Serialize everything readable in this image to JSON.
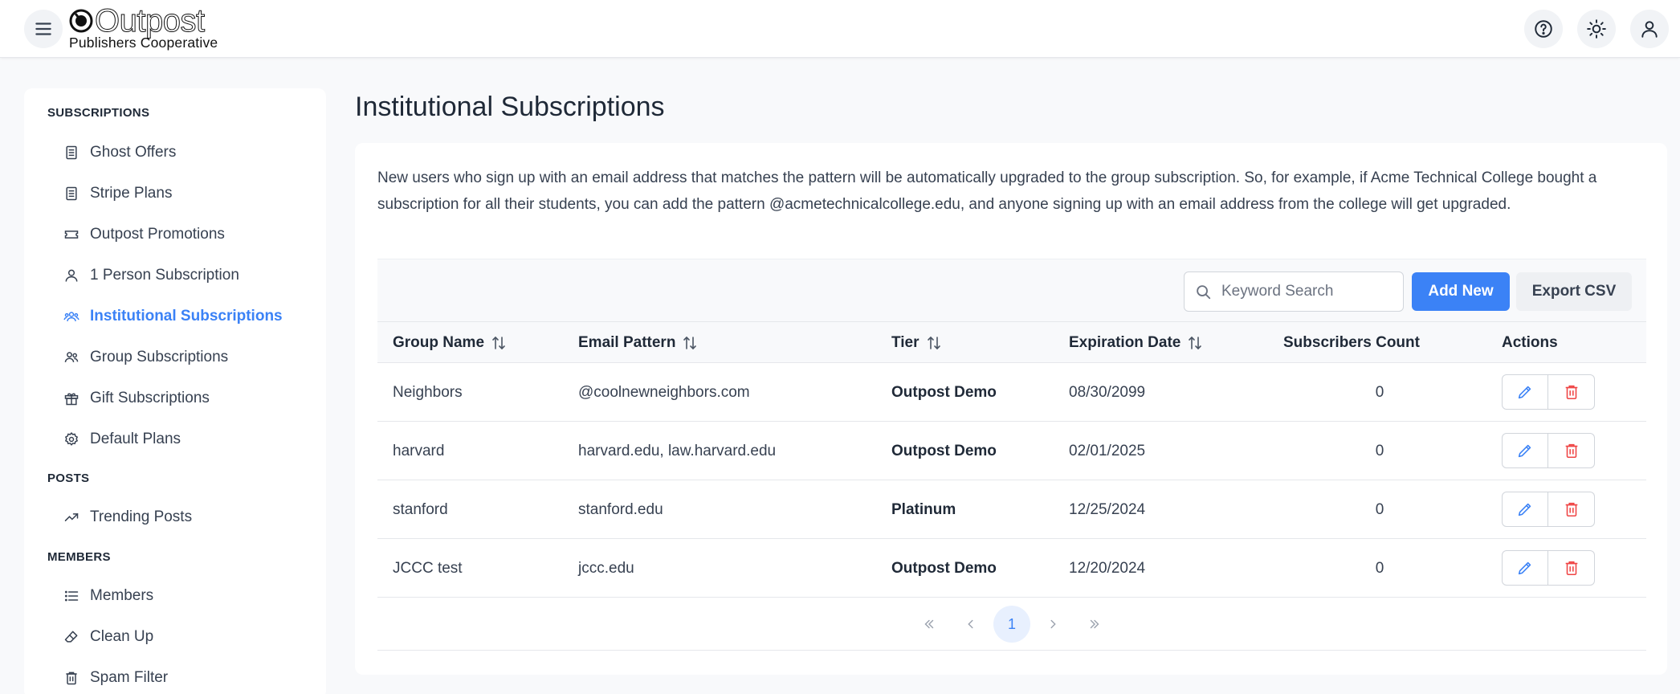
{
  "app": {
    "logo_word": "Outpost",
    "logo_sub": "Publishers Cooperative"
  },
  "sidebar": {
    "sections": [
      {
        "title": "SUBSCRIPTIONS",
        "items": [
          {
            "label": "Ghost Offers",
            "icon": "document-icon"
          },
          {
            "label": "Stripe Plans",
            "icon": "document-icon"
          },
          {
            "label": "Outpost Promotions",
            "icon": "ticket-icon"
          },
          {
            "label": "1 Person Subscription",
            "icon": "user-icon"
          },
          {
            "label": "Institutional Subscriptions",
            "icon": "users-icon",
            "active": true
          },
          {
            "label": "Group Subscriptions",
            "icon": "users-icon"
          },
          {
            "label": "Gift Subscriptions",
            "icon": "gift-icon"
          },
          {
            "label": "Default Plans",
            "icon": "gear-icon"
          }
        ]
      },
      {
        "title": "POSTS",
        "items": [
          {
            "label": "Trending Posts",
            "icon": "trending-icon"
          }
        ]
      },
      {
        "title": "MEMBERS",
        "items": [
          {
            "label": "Members",
            "icon": "list-icon"
          },
          {
            "label": "Clean Up",
            "icon": "eraser-icon"
          },
          {
            "label": "Spam Filter",
            "icon": "trash-icon"
          }
        ]
      }
    ]
  },
  "main": {
    "title": "Institutional Subscriptions",
    "description": "New users who sign up with an email address that matches the pattern will be automatically upgraded to the group subscription. So, for example, if Acme Technical College bought a subscription for all their students, you can add the pattern @acmetechnicalcollege.edu, and anyone signing up with an email address from the college will get upgraded.",
    "search_placeholder": "Keyword Search",
    "add_label": "Add New",
    "export_label": "Export CSV",
    "columns": [
      "Group Name",
      "Email Pattern",
      "Tier",
      "Expiration Date",
      "Subscribers Count",
      "Actions"
    ],
    "rows": [
      {
        "group": "Neighbors",
        "pattern": "@coolnewneighbors.com",
        "tier": "Outpost Demo",
        "expires": "08/30/2099",
        "count": "0"
      },
      {
        "group": "harvard",
        "pattern": "harvard.edu, law.harvard.edu",
        "tier": "Outpost Demo",
        "expires": "02/01/2025",
        "count": "0"
      },
      {
        "group": "stanford",
        "pattern": "stanford.edu",
        "tier": "Platinum",
        "expires": "12/25/2024",
        "count": "0"
      },
      {
        "group": "JCCC test",
        "pattern": "jccc.edu",
        "tier": "Outpost Demo",
        "expires": "12/20/2024",
        "count": "0"
      }
    ],
    "pagination": {
      "current": "1"
    }
  },
  "colors": {
    "accent": "#3b82f6",
    "danger": "#ef4444"
  }
}
